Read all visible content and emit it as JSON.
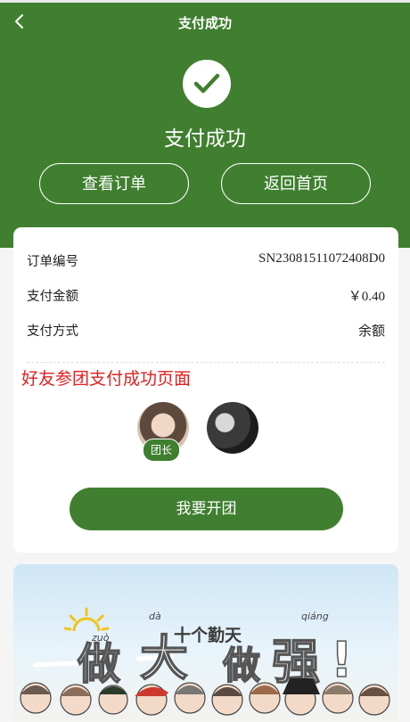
{
  "nav": {
    "title": "支付成功"
  },
  "status": {
    "title": "支付成功"
  },
  "actions": {
    "view_orders": "查看订单",
    "back_home": "返回首页"
  },
  "order": {
    "rows": [
      {
        "label": "订单编号",
        "value": "SN23081511072408D0"
      },
      {
        "label": "支付金额",
        "value": "￥0.40"
      },
      {
        "label": "支付方式",
        "value": "余额"
      }
    ]
  },
  "notice": "好友参团支付成功页面",
  "group": {
    "leader_badge": "团长"
  },
  "cta": "我要开团",
  "banner": {
    "pinyin": [
      "zuò",
      "dà",
      "qiáng"
    ],
    "slogan_small": "十个勤天",
    "slogan_big": [
      "做",
      "大",
      "做",
      "强"
    ]
  },
  "colors": {
    "primary": "#3f7f2f",
    "notice": "#e02020"
  }
}
